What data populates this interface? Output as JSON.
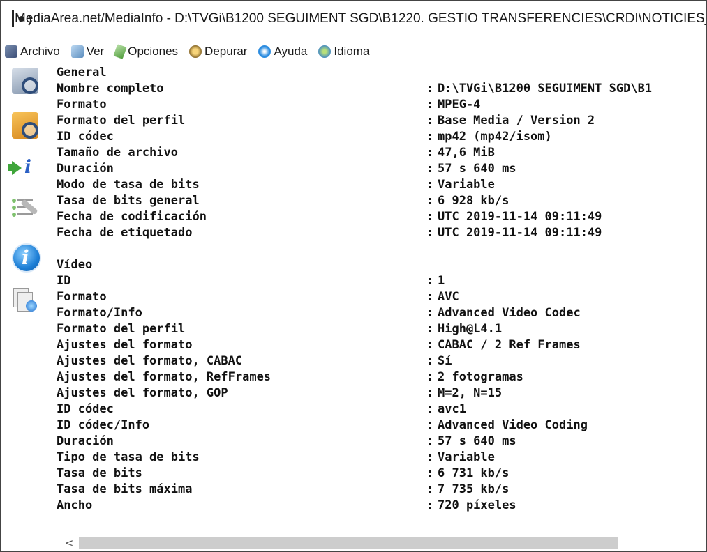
{
  "window": {
    "title": "MediaArea.net/MediaInfo - D:\\TVGi\\B1200 SEGUIMENT SGD\\B1220. GESTIO TRANSFERENCIES\\CRDI\\NOTICIES_M"
  },
  "menu": {
    "items": [
      {
        "label": "Archivo",
        "icon": "archive-icon"
      },
      {
        "label": "Ver",
        "icon": "view-icon"
      },
      {
        "label": "Opciones",
        "icon": "options-icon"
      },
      {
        "label": "Depurar",
        "icon": "debug-icon"
      },
      {
        "label": "Ayuda",
        "icon": "help-icon"
      },
      {
        "label": "Idioma",
        "icon": "language-icon"
      }
    ]
  },
  "sidebar": {
    "icons": [
      "open-file-icon",
      "open-folder-icon",
      "info-export-icon",
      "tools-icon",
      "about-icon",
      "sheet-view-icon"
    ]
  },
  "info": {
    "rows": [
      {
        "key": "General",
        "value": ""
      },
      {
        "key": "Nombre completo",
        "value": "D:\\TVGi\\B1200 SEGUIMENT SGD\\B1"
      },
      {
        "key": "Formato",
        "value": "MPEG-4"
      },
      {
        "key": "Formato del perfil",
        "value": "Base Media / Version 2"
      },
      {
        "key": "ID códec",
        "value": "mp42 (mp42/isom)"
      },
      {
        "key": "Tamaño de archivo",
        "value": "47,6 MiB"
      },
      {
        "key": "Duración",
        "value": "57 s 640 ms"
      },
      {
        "key": "Modo de tasa de bits",
        "value": "Variable"
      },
      {
        "key": "Tasa de bits general",
        "value": "6 928 kb/s"
      },
      {
        "key": "Fecha de codificación",
        "value": "UTC 2019-11-14 09:11:49"
      },
      {
        "key": "Fecha de etiquetado",
        "value": "UTC 2019-11-14 09:11:49"
      },
      {
        "key": "",
        "value": ""
      },
      {
        "key": "Vídeo",
        "value": ""
      },
      {
        "key": "ID",
        "value": "1"
      },
      {
        "key": "Formato",
        "value": "AVC"
      },
      {
        "key": "Formato/Info",
        "value": "Advanced Video Codec"
      },
      {
        "key": "Formato del perfil",
        "value": "High@L4.1"
      },
      {
        "key": "Ajustes del formato",
        "value": "CABAC / 2 Ref Frames"
      },
      {
        "key": "Ajustes del formato, CABAC",
        "value": "Sí"
      },
      {
        "key": "Ajustes del formato, RefFrames",
        "value": "2 fotogramas"
      },
      {
        "key": "Ajustes del formato, GOP",
        "value": "M=2, N=15"
      },
      {
        "key": "ID códec",
        "value": "avc1"
      },
      {
        "key": "ID códec/Info",
        "value": "Advanced Video Coding"
      },
      {
        "key": "Duración",
        "value": "57 s 640 ms"
      },
      {
        "key": "Tipo de tasa de bits",
        "value": "Variable"
      },
      {
        "key": "Tasa de bits",
        "value": "6 731 kb/s"
      },
      {
        "key": "Tasa de bits máxima",
        "value": "7 735 kb/s"
      },
      {
        "key": "Ancho",
        "value": "720 píxeles"
      }
    ]
  },
  "scrollbar": {
    "left_arrow": "<"
  }
}
